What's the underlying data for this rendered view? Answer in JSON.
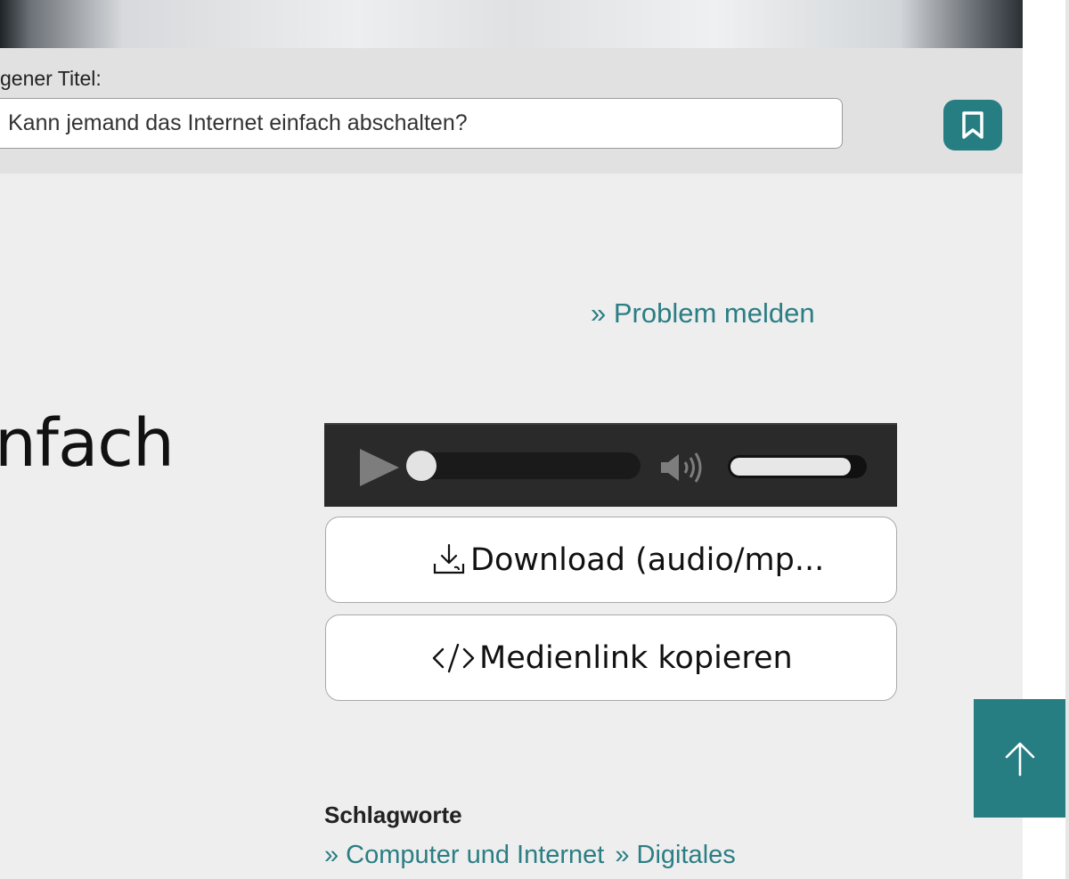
{
  "header": {
    "custom_title_label": "gener Titel:",
    "custom_title_value": "Kann jemand das Internet einfach abschalten?"
  },
  "main": {
    "report_problem": "» Problem melden",
    "heading_fragment": "nfach"
  },
  "player": {
    "progress": 0,
    "volume": 0.9
  },
  "actions": {
    "download_label": "Download (audio/mp...",
    "copy_link_label": "Medienlink kopieren"
  },
  "tags": {
    "heading": "Schlagworte",
    "items": [
      "» Computer und Internet",
      "» Digitales"
    ]
  },
  "colors": {
    "accent": "#277e82",
    "link": "#2b7e84",
    "background": "#eeeeee"
  },
  "icons": [
    "bookmark-icon",
    "play-icon",
    "volume-icon",
    "download-icon",
    "code-icon",
    "arrow-up-icon"
  ]
}
